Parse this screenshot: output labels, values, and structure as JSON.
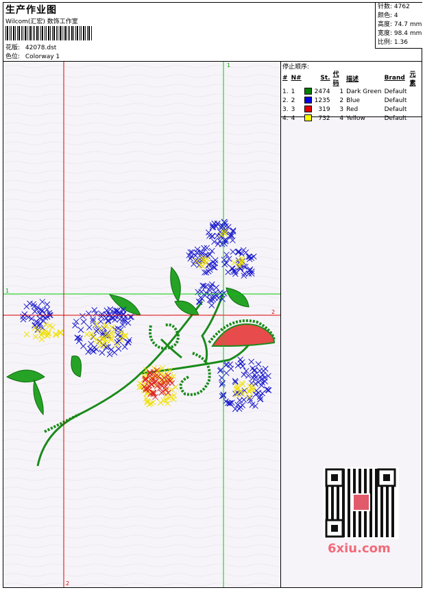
{
  "header": {
    "title": "生产作业图",
    "company": "Wilcom(汇宏) 数饰工作室",
    "design_label": "花版:",
    "design_value": "42078.dst",
    "colorway_label": "色位:",
    "colorway_value": "Colorway 1"
  },
  "stats": [
    {
      "label": "针数:",
      "value": "4762"
    },
    {
      "label": "颜色:",
      "value": "4"
    },
    {
      "label": "高度:",
      "value": "74.7 mm"
    },
    {
      "label": "宽度:",
      "value": "98.4 mm"
    },
    {
      "label": "比例:",
      "value": "1.36"
    }
  ],
  "stop_panel": {
    "heading": "停止顺序:",
    "columns": [
      "#",
      "N#",
      "St.",
      "代码",
      "描述",
      "Brand",
      "元素"
    ],
    "rows": [
      {
        "idx": "1.",
        "n": "1",
        "color": "#008000",
        "st": "2474",
        "code": "1",
        "desc": "Dark Green",
        "brand": "Default"
      },
      {
        "idx": "2.",
        "n": "2",
        "color": "#0000e0",
        "st": "1235",
        "code": "2",
        "desc": "Blue",
        "brand": "Default"
      },
      {
        "idx": "3.",
        "n": "3",
        "color": "#e00000",
        "st": "319",
        "code": "3",
        "desc": "Red",
        "brand": "Default"
      },
      {
        "idx": "4.",
        "n": "4",
        "color": "#ffff00",
        "st": "732",
        "code": "4",
        "desc": "Yellow",
        "brand": "Default"
      }
    ]
  },
  "axes": {
    "top": "1",
    "left": "1",
    "right": "2",
    "bottom": "2"
  },
  "watermark": "6xiu.com",
  "colors": {
    "green": "#1a8a1a",
    "blue": "#1a1acc",
    "red": "#dd2222",
    "yellow": "#f0e000",
    "guide_red": "#dd0000",
    "guide_green": "#00cc00"
  }
}
